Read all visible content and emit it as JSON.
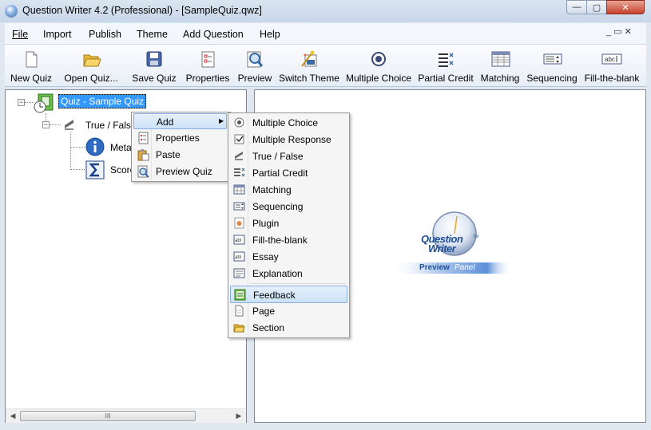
{
  "window": {
    "title": "Question Writer 4.2 (Professional) - [SampleQuiz.qwz]",
    "min_glyph": "▭",
    "max_glyph": "▢",
    "close_glyph": "✕"
  },
  "menubar": {
    "items": [
      "File",
      "Import",
      "Publish",
      "Theme",
      "Add Question",
      "Help"
    ],
    "mdi_buttons": "_ ▭ ✕"
  },
  "toolbar": {
    "buttons": [
      {
        "label": "New Quiz",
        "icon": "new-quiz-icon"
      },
      {
        "label": "Open Quiz...",
        "icon": "open-quiz-icon"
      },
      {
        "label": "Save Quiz",
        "icon": "save-quiz-icon"
      },
      {
        "label": "Properties",
        "icon": "properties-icon"
      },
      {
        "label": "Preview",
        "icon": "preview-icon"
      },
      {
        "label": "Switch Theme",
        "icon": "switch-theme-icon"
      },
      {
        "label": "Multiple Choice",
        "icon": "multiple-choice-icon"
      },
      {
        "label": "Partial Credit",
        "icon": "partial-credit-icon"
      },
      {
        "label": "Matching",
        "icon": "matching-icon"
      },
      {
        "label": "Sequencing",
        "icon": "sequencing-icon"
      },
      {
        "label": "Fill-the-blank",
        "icon": "fill-the-blank-icon"
      }
    ]
  },
  "tree": {
    "root": "Quiz - Sample Quiz",
    "child": "True / False",
    "leaf1": "Metad",
    "leaf2": "Score",
    "expander_symbol": "−"
  },
  "context_menu": {
    "items": [
      "Add",
      "Properties",
      "Paste",
      "Preview Quiz"
    ],
    "submenu_arrow": "▶"
  },
  "submenu": {
    "items": [
      "Multiple Choice",
      "Multiple Response",
      "True / False",
      "Partial Credit",
      "Matching",
      "Sequencing",
      "Plugin",
      "Fill-the-blank",
      "Essay",
      "Explanation"
    ],
    "items2": [
      "Feedback",
      "Page",
      "Section"
    ],
    "highlighted": "Feedback"
  },
  "logo": {
    "line1": "Question",
    "line2": "Writer",
    "tm": "TM",
    "panel_prefix": "Preview",
    "panel_suffix": "Panel"
  },
  "scrollbar": {
    "left_arrow": "◀",
    "right_arrow": "▶",
    "grip": "III"
  },
  "colors": {
    "selection": "#3399ff",
    "menu_highlight": "#cde3f8",
    "logo_blue": "#1f4e96"
  }
}
